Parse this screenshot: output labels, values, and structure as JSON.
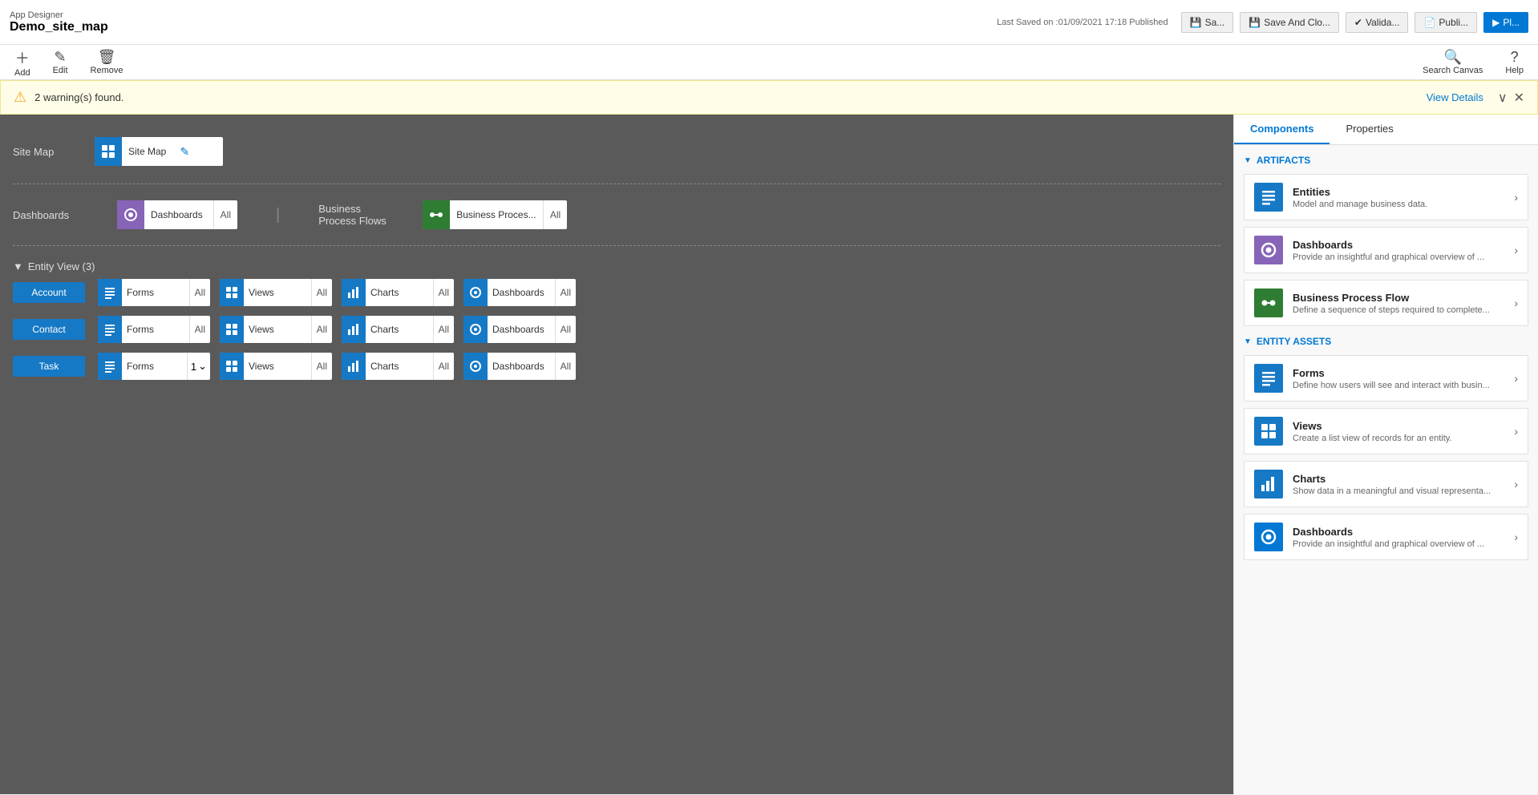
{
  "app": {
    "designer_label": "App Designer",
    "app_name": "Demo_site_map",
    "last_saved": "Last Saved on :01/09/2021 17:18 Published"
  },
  "toolbar": {
    "buttons": [
      {
        "id": "save",
        "label": "Sa..."
      },
      {
        "id": "save-close",
        "label": "Save And Clo..."
      },
      {
        "id": "validate",
        "label": "Valida..."
      },
      {
        "id": "publish",
        "label": "Publi..."
      },
      {
        "id": "play",
        "label": "Pl..."
      }
    ],
    "tools": [
      {
        "id": "add",
        "label": "Add",
        "icon": "+"
      },
      {
        "id": "edit",
        "label": "Edit",
        "icon": "✎"
      },
      {
        "id": "remove",
        "label": "Remove",
        "icon": "🗑"
      }
    ],
    "search_canvas_label": "Search Canvas",
    "help_label": "Help"
  },
  "warning": {
    "text": "2 warning(s) found.",
    "view_details": "View Details"
  },
  "canvas": {
    "sitemap_label": "Site Map",
    "sitemap_node": "Site Map",
    "dashboards_label": "Dashboards",
    "dashboards_node": "Dashboards",
    "dashboards_badge": "All",
    "bpf_label": "Business Process Flows",
    "bpf_node": "Business Proces...",
    "bpf_badge": "All",
    "entity_section": {
      "header": "Entity View (3)",
      "entities": [
        {
          "name": "Account",
          "assets": [
            {
              "type": "Forms",
              "badge": "All"
            },
            {
              "type": "Views",
              "badge": "All"
            },
            {
              "type": "Charts",
              "badge": "All"
            },
            {
              "type": "Dashboards",
              "badge": "All"
            }
          ]
        },
        {
          "name": "Contact",
          "assets": [
            {
              "type": "Forms",
              "badge": "All"
            },
            {
              "type": "Views",
              "badge": "All"
            },
            {
              "type": "Charts",
              "badge": "All"
            },
            {
              "type": "Dashboards",
              "badge": "All"
            }
          ]
        },
        {
          "name": "Task",
          "assets": [
            {
              "type": "Forms",
              "badge": "1",
              "has_arrow": true
            },
            {
              "type": "Views",
              "badge": "All"
            },
            {
              "type": "Charts",
              "badge": "All"
            },
            {
              "type": "Dashboards",
              "badge": "All"
            }
          ]
        }
      ]
    }
  },
  "right_panel": {
    "tabs": [
      {
        "id": "components",
        "label": "Components"
      },
      {
        "id": "properties",
        "label": "Properties"
      }
    ],
    "active_tab": "components",
    "artifacts_label": "ARTIFACTS",
    "entity_assets_label": "ENTITY ASSETS",
    "components": [
      {
        "id": "entities",
        "icon_type": "blue",
        "icon": "☰",
        "title": "Entities",
        "description": "Model and manage business data."
      },
      {
        "id": "dashboards",
        "icon_type": "purple",
        "icon": "◉",
        "title": "Dashboards",
        "description": "Provide an insightful and graphical overview of ..."
      },
      {
        "id": "bpf",
        "icon_type": "green",
        "icon": "⚙",
        "title": "Business Process Flow",
        "description": "Define a sequence of steps required to complete..."
      }
    ],
    "entity_assets": [
      {
        "id": "forms",
        "icon_type": "blue",
        "icon": "☰",
        "title": "Forms",
        "description": "Define how users will see and interact with busin..."
      },
      {
        "id": "views",
        "icon_type": "blue",
        "icon": "⊞",
        "title": "Views",
        "description": "Create a list view of records for an entity."
      },
      {
        "id": "charts",
        "icon_type": "blue-chart",
        "icon": "📊",
        "title": "Charts",
        "description": "Show data in a meaningful and visual representa..."
      },
      {
        "id": "ea-dashboards",
        "icon_type": "blue-dash",
        "icon": "◉",
        "title": "Dashboards",
        "description": "Provide an insightful and graphical overview of ..."
      }
    ]
  }
}
